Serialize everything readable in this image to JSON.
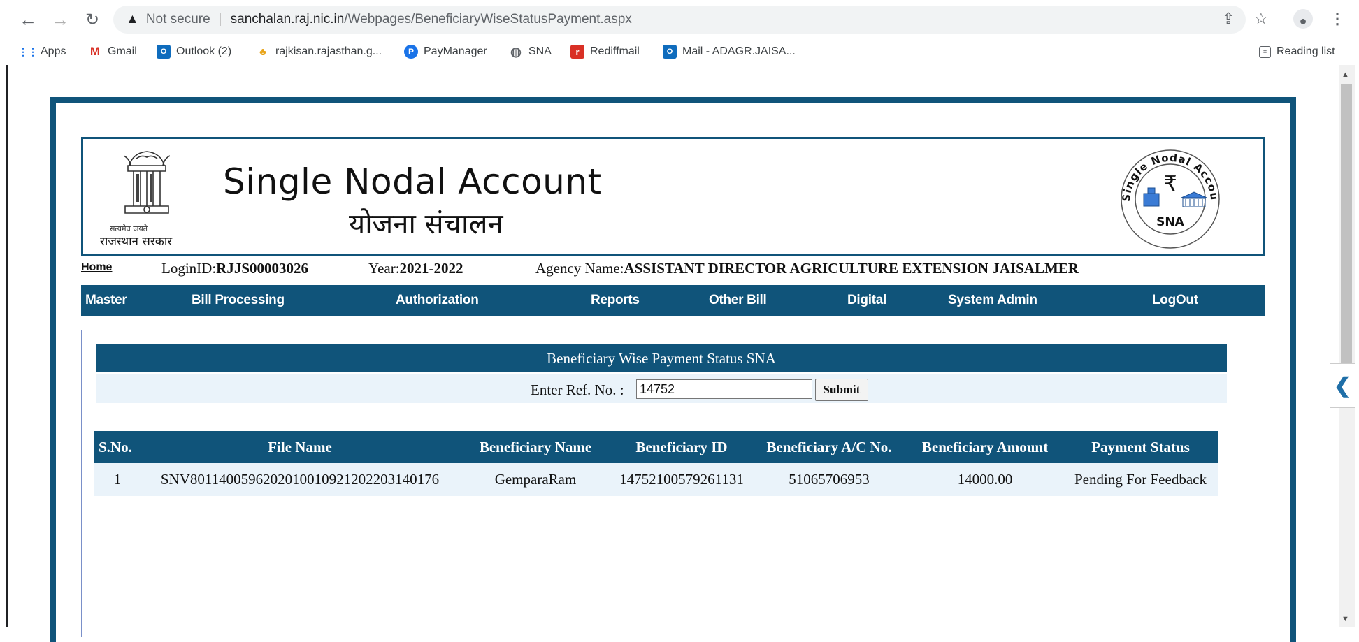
{
  "browser": {
    "security_label": "Not secure",
    "url_host": "sanchalan.raj.nic.in",
    "url_path": "/Webpages/BeneficiaryWiseStatusPayment.aspx",
    "bookmarks": [
      "Apps",
      "Gmail",
      "Outlook (2)",
      "rajkisan.rajasthan.g...",
      "PayManager",
      "SNA",
      "Rediffmail",
      "Mail - ADAGR.JAISA..."
    ],
    "reading_list": "Reading list"
  },
  "header": {
    "emblem_caption_top": "सत्यमेव जयते",
    "emblem_caption": "राजस्थान सरकार",
    "title": "Single Nodal Account",
    "subtitle": "योजना संचालन",
    "logo_ring_text": "Single Nodal Account",
    "logo_text": "SNA",
    "logo_symbol": "₹"
  },
  "info": {
    "home_label": "Home",
    "login_label": "LoginID:",
    "login_value": "RJJS00003026",
    "year_label": "Year:",
    "year_value": "2021-2022",
    "agency_label": "Agency Name:",
    "agency_value": "ASSISTANT DIRECTOR AGRICULTURE EXTENSION JAISALMER"
  },
  "menu": [
    "Master",
    "Bill Processing",
    "Authorization",
    "Reports",
    "Other Bill",
    "Digital",
    "System Admin",
    "LogOut"
  ],
  "panel": {
    "title": "Beneficiary Wise Payment Status SNA",
    "ref_label": "Enter Ref. No. :",
    "ref_value": "14752",
    "submit_label": "Submit"
  },
  "table": {
    "headers": [
      "S.No.",
      "File Name",
      "Beneficiary Name",
      "Beneficiary ID",
      "Beneficiary A/C No.",
      "Beneficiary Amount",
      "Payment Status"
    ],
    "rows": [
      [
        "1",
        "SNV801140059620201001092120220314017​6",
        "GemparaRam",
        "14752100579261131",
        "51065706953",
        "14000.00",
        "Pending For Feedback"
      ]
    ]
  }
}
